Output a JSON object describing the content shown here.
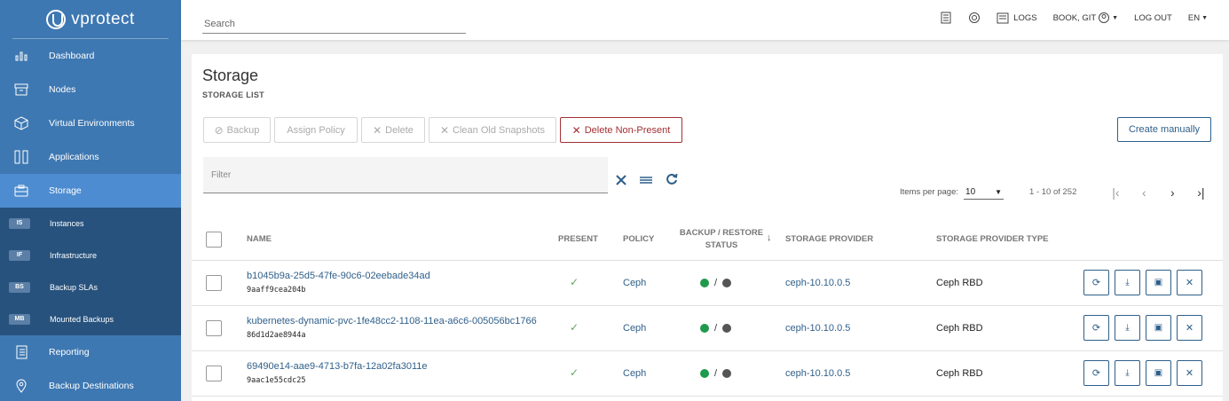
{
  "app": {
    "name": "vprotect"
  },
  "sidebar": {
    "items": [
      {
        "label": "Dashboard",
        "icon": "chart-icon"
      },
      {
        "label": "Nodes",
        "icon": "archive-icon"
      },
      {
        "label": "Virtual Environments",
        "icon": "cube-icon"
      },
      {
        "label": "Applications",
        "icon": "columns-icon"
      },
      {
        "label": "Storage",
        "icon": "storage-icon",
        "active": true
      }
    ],
    "subitems": [
      {
        "badge": "IS",
        "label": "Instances"
      },
      {
        "badge": "IF",
        "label": "Infrastructure"
      },
      {
        "badge": "BS",
        "label": "Backup SLAs"
      },
      {
        "badge": "MB",
        "label": "Mounted Backups"
      }
    ],
    "bottom_items": [
      {
        "label": "Reporting",
        "icon": "report-icon"
      },
      {
        "label": "Backup Destinations",
        "icon": "location-icon"
      }
    ]
  },
  "topbar": {
    "search_placeholder": "Search",
    "logs_label": "LOGS",
    "user_label": "BOOK, GIT",
    "logout_label": "LOG OUT",
    "lang_label": "EN"
  },
  "page": {
    "title": "Storage",
    "subtitle": "STORAGE LIST"
  },
  "actions": {
    "backup": "Backup",
    "assign_policy": "Assign Policy",
    "delete": "Delete",
    "clean_snapshots": "Clean Old Snapshots",
    "delete_non_present": "Delete Non-Present",
    "create_manually": "Create manually"
  },
  "filter": {
    "placeholder": "Filter"
  },
  "pager": {
    "items_per_page_label": "Items per page:",
    "items_per_page_value": "10",
    "range": "1 - 10 of 252"
  },
  "table": {
    "headers": {
      "name": "NAME",
      "present": "PRESENT",
      "policy": "POLICY",
      "status_line1": "BACKUP / RESTORE",
      "status_line2": "STATUS",
      "provider": "STORAGE PROVIDER",
      "provider_type": "STORAGE PROVIDER TYPE"
    },
    "rows": [
      {
        "name": "b1045b9a-25d5-47fe-90c6-02eebade34ad",
        "id": "9aaff9cea204b",
        "policy": "Ceph",
        "provider": "ceph-10.10.0.5",
        "type": "Ceph RBD"
      },
      {
        "name": "kubernetes-dynamic-pvc-1fe48cc2-1108-11ea-a6c6-005056bc1766",
        "id": "86d1d2ae8944a",
        "policy": "Ceph",
        "provider": "ceph-10.10.0.5",
        "type": "Ceph RBD"
      },
      {
        "name": "69490e14-aae9-4713-b7fa-12a02fa3011e",
        "id": "9aac1e55cdc25",
        "policy": "Ceph",
        "provider": "ceph-10.10.0.5",
        "type": "Ceph RBD"
      }
    ]
  },
  "colors": {
    "sidebar": "#3e78b2",
    "accent": "#2f5f8a",
    "danger": "#a23033",
    "status_green": "#1f9a4d",
    "status_gray": "#555555"
  }
}
